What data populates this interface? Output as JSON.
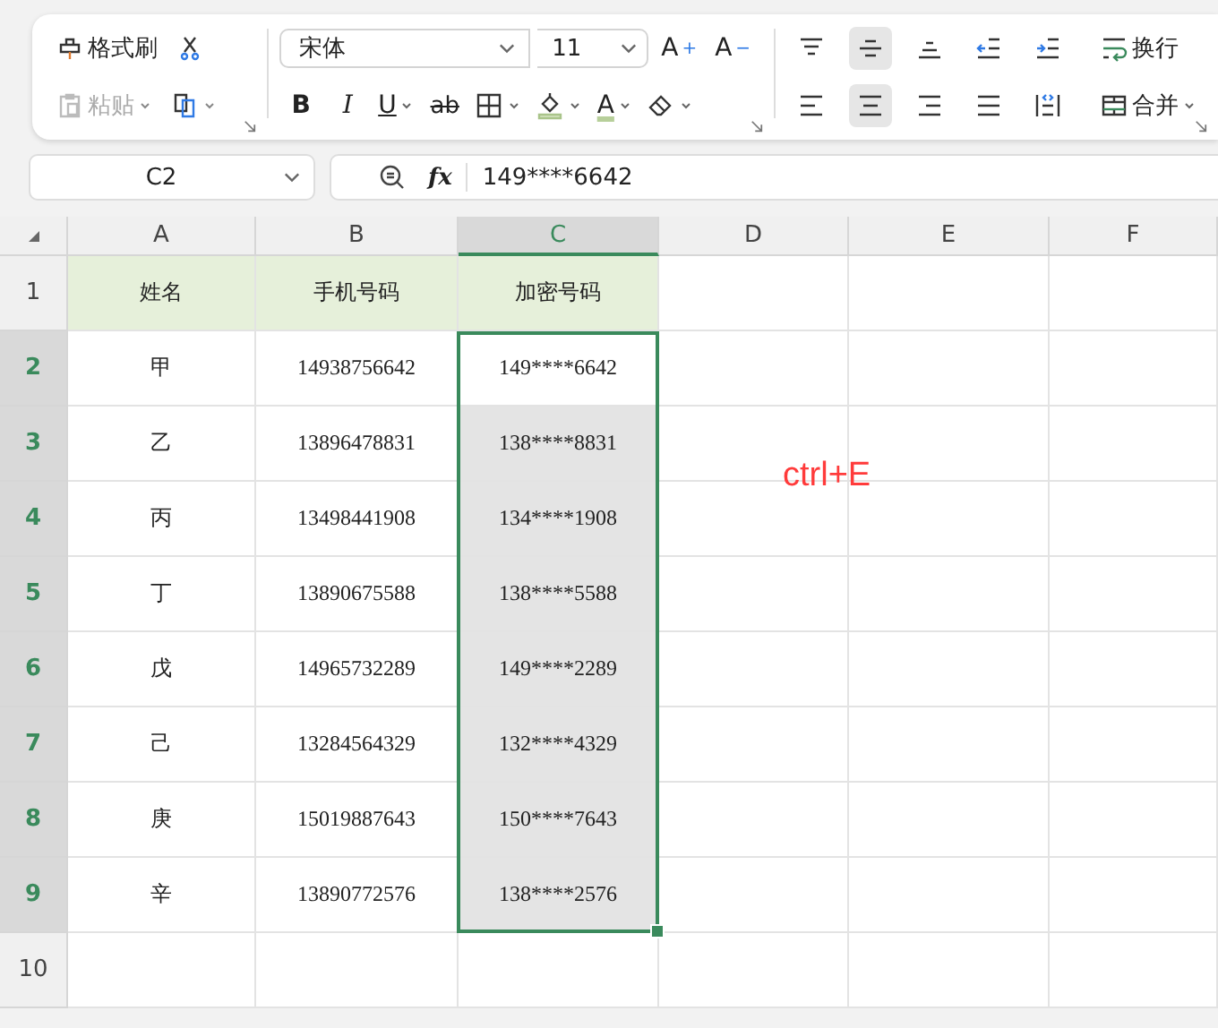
{
  "toolbar": {
    "clipboard": [
      {
        "kind": "format_painter",
        "label": "格式刷",
        "disabled": false,
        "dropdown": false
      },
      {
        "kind": "cut",
        "disabled": false,
        "dropdown": false
      },
      {
        "kind": "paste",
        "label": "粘贴",
        "disabled": true,
        "dropdown": true
      },
      {
        "kind": "copy",
        "disabled": false,
        "dropdown": true
      }
    ],
    "font_name": "宋体",
    "font_size": "11",
    "font_row1": [
      {
        "glyph": "A",
        "sup": "+"
      },
      {
        "glyph": "A",
        "sup": "−"
      }
    ],
    "font_row2": [
      {
        "kind": "bold",
        "glyph": "B",
        "dropdown": false
      },
      {
        "kind": "italic",
        "glyph": "I",
        "dropdown": false
      },
      {
        "kind": "underline",
        "glyph": "U",
        "dropdown": true
      },
      {
        "kind": "strikethrough",
        "glyph": "ab",
        "dropdown": false
      },
      {
        "kind": "borders",
        "dropdown": true
      },
      {
        "kind": "fill_color",
        "dropdown": true
      },
      {
        "kind": "font_color",
        "glyph": "A",
        "dropdown": true
      },
      {
        "kind": "clear",
        "dropdown": true
      }
    ],
    "align_row1": [
      {
        "kind": "align_top",
        "selected": false
      },
      {
        "kind": "align_middle",
        "selected": true
      },
      {
        "kind": "align_bottom",
        "selected": false
      },
      {
        "kind": "indent_decrease",
        "selected": false
      },
      {
        "kind": "indent_increase",
        "selected": false
      },
      {
        "kind": "wrap",
        "label": "换行",
        "selected": false
      }
    ],
    "align_row2": [
      {
        "kind": "align_left",
        "selected": false
      },
      {
        "kind": "align_center",
        "selected": true
      },
      {
        "kind": "align_right",
        "selected": false
      },
      {
        "kind": "justify",
        "selected": false
      },
      {
        "kind": "distribute",
        "selected": false
      },
      {
        "kind": "merge",
        "label": "合并",
        "selected": false
      }
    ]
  },
  "formula_bar": {
    "name_box": "C2",
    "fx": "fx",
    "formula": "149****6642"
  },
  "columns": [
    {
      "label": "A",
      "selected": false
    },
    {
      "label": "B",
      "selected": false
    },
    {
      "label": "C",
      "selected": true
    },
    {
      "label": "D",
      "selected": false
    },
    {
      "label": "E",
      "selected": false
    },
    {
      "label": "F",
      "selected": false
    }
  ],
  "rows": [
    {
      "number": "1",
      "kind": "header",
      "selected": false,
      "cells": [
        "姓名",
        "手机号码",
        "加密号码"
      ]
    },
    {
      "number": "2",
      "kind": "data",
      "selected": true,
      "cells": [
        "甲",
        "14938756642",
        "149****6642"
      ]
    },
    {
      "number": "3",
      "kind": "data",
      "selected": true,
      "cells": [
        "乙",
        "13896478831",
        "138****8831"
      ]
    },
    {
      "number": "4",
      "kind": "data",
      "selected": true,
      "cells": [
        "丙",
        "13498441908",
        "134****1908"
      ]
    },
    {
      "number": "5",
      "kind": "data",
      "selected": true,
      "cells": [
        "丁",
        "13890675588",
        "138****5588"
      ]
    },
    {
      "number": "6",
      "kind": "data",
      "selected": true,
      "cells": [
        "戊",
        "14965732289",
        "149****2289"
      ]
    },
    {
      "number": "7",
      "kind": "data",
      "selected": true,
      "cells": [
        "己",
        "13284564329",
        "132****4329"
      ]
    },
    {
      "number": "8",
      "kind": "data",
      "selected": true,
      "cells": [
        "庚",
        "15019887643",
        "150****7643"
      ]
    },
    {
      "number": "9",
      "kind": "data",
      "selected": true,
      "cells": [
        "辛",
        "13890772576",
        "138****2576"
      ]
    },
    {
      "number": "10",
      "kind": "data",
      "selected": false,
      "cells": []
    }
  ],
  "annotation": {
    "text": "ctrl+E"
  }
}
